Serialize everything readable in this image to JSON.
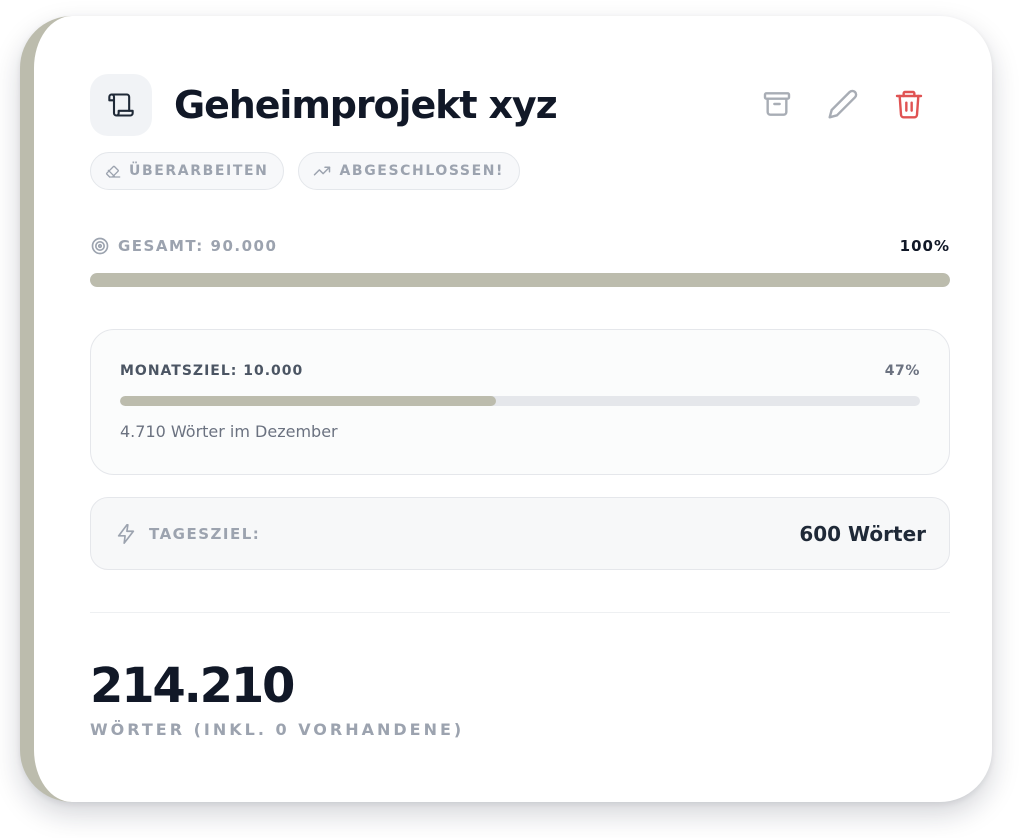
{
  "project": {
    "title": "Geheimprojekt xyz",
    "icon": "scroll-icon",
    "accent_color": "#bcbcad"
  },
  "actions": [
    {
      "icon": "archive-icon",
      "color": "#a8adb5"
    },
    {
      "icon": "pencil-icon",
      "color": "#a8adb5"
    },
    {
      "icon": "trash-icon",
      "color": "#e05353"
    }
  ],
  "chips": [
    {
      "label": "ÜBERARBEITEN",
      "icon": "eraser-icon"
    },
    {
      "label": "ABGESCHLOSSEN!",
      "icon": "trending-up-icon"
    }
  ],
  "total": {
    "icon": "target-icon",
    "label": "GESAMT: 90.000",
    "percent_text": "100%",
    "progress": 100
  },
  "monthly": {
    "label": "MONATSZIEL: 10.000",
    "percent_text": "47%",
    "progress": 47,
    "subtitle": "4.710 Wörter im Dezember"
  },
  "daily": {
    "icon": "lightning-icon",
    "label": "TAGESZIEL:",
    "value": "600 Wörter"
  },
  "summary": {
    "word_count": "214.210",
    "caption": "WÖRTER (INKL. 0 VORHANDENE)"
  }
}
